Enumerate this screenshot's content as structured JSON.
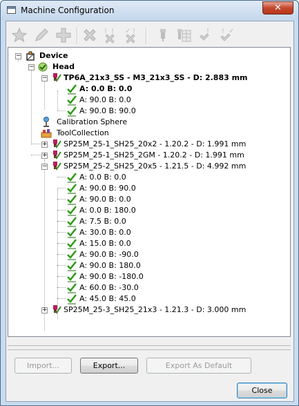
{
  "window": {
    "title": "Machine Configuration",
    "close_glyph": "✕"
  },
  "toolbar": {
    "icons": [
      "star-icon",
      "pencil-icon",
      "plus-icon",
      "delete-x-icon",
      "mark-x-icon",
      "mark-check-icon",
      "probe-icon",
      "probe-table-icon",
      "table-mark-icon",
      "check-mark-icon"
    ]
  },
  "tree": {
    "device": "Device",
    "head": "Head",
    "probe_main": "TP6A_21x3_SS - M3_21x3_SS - D:  2.883 mm",
    "probe_main_angles": [
      "A:  0.0 B:  0.0",
      "A: 90.0 B:  0.0",
      "A: 90.0 B: 90.0"
    ],
    "calibration_sphere": "Calibration Sphere",
    "tool_collection": "ToolCollection",
    "tools": [
      {
        "label": "SP25M_25-1_SH25_20x2 - 1.20.2 - D:  1.991 mm"
      },
      {
        "label": "SP25M_25-1_SH25_2GM - 1.20.2 - D:  1.991 mm"
      },
      {
        "label": "SP25M_25-2_SH25_20x5 - 1.21.5 - D:  4.992 mm"
      },
      {
        "label": "SP25M_25-3_SH25_21x3 - 1.21.3 - D:  3.000 mm"
      }
    ],
    "tool3_angles": [
      "A:  0.0 B:  0.0",
      "A: 90.0 B: 90.0",
      "A: 90.0 B:  0.0",
      "A:  0.0 B: 180.0",
      "A:  7.5 B:  0.0",
      "A: 30.0 B:  0.0",
      "A: 15.0 B:  0.0",
      "A: 90.0 B: -90.0",
      "A: 90.0 B: 180.0",
      "A: 90.0 B: -180.0",
      "A: 60.0 B: -30.0",
      "A: 45.0 B: 45.0"
    ]
  },
  "buttons": {
    "import": "Import...",
    "export": "Export...",
    "export_default": "Export As Default",
    "close": "Close"
  }
}
